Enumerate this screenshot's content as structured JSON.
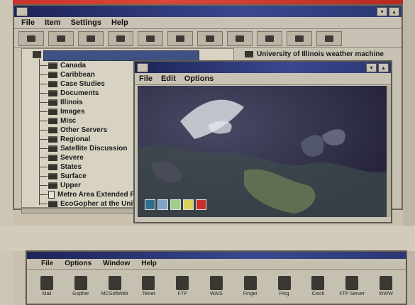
{
  "main_window": {
    "menu": [
      "File",
      "Item",
      "Settings",
      "Help"
    ],
    "tree_root": "",
    "tree_items": [
      {
        "label": "Canada",
        "kind": "folder"
      },
      {
        "label": "Caribbean",
        "kind": "folder"
      },
      {
        "label": "Case Studies",
        "kind": "folder"
      },
      {
        "label": "Documents",
        "kind": "folder"
      },
      {
        "label": "Illinois",
        "kind": "folder"
      },
      {
        "label": "Images",
        "kind": "folder"
      },
      {
        "label": "Misc",
        "kind": "folder"
      },
      {
        "label": "Other Servers",
        "kind": "folder"
      },
      {
        "label": "Regional",
        "kind": "folder"
      },
      {
        "label": "Satellite Discussion",
        "kind": "folder"
      },
      {
        "label": "Severe",
        "kind": "folder"
      },
      {
        "label": "States",
        "kind": "folder"
      },
      {
        "label": "Surface",
        "kind": "folder"
      },
      {
        "label": "Upper",
        "kind": "folder"
      },
      {
        "label": "Metro Area Extended F...",
        "kind": "doc"
      },
      {
        "label": "EcoGopher at the Univer...",
        "kind": "folder"
      }
    ],
    "right_panel_label": "University of Illinois weather machine"
  },
  "image_window": {
    "menu": [
      "File",
      "Edit",
      "Options"
    ]
  },
  "launcher": {
    "menu": [
      "File",
      "Options",
      "Window",
      "Help"
    ],
    "apps": [
      "Mail",
      "Gopher",
      "MCSoftWeb",
      "Telnet",
      "FTP",
      "WAIS",
      "Finger",
      "Ping",
      "Clock",
      "FTP Server",
      "WWW"
    ]
  }
}
